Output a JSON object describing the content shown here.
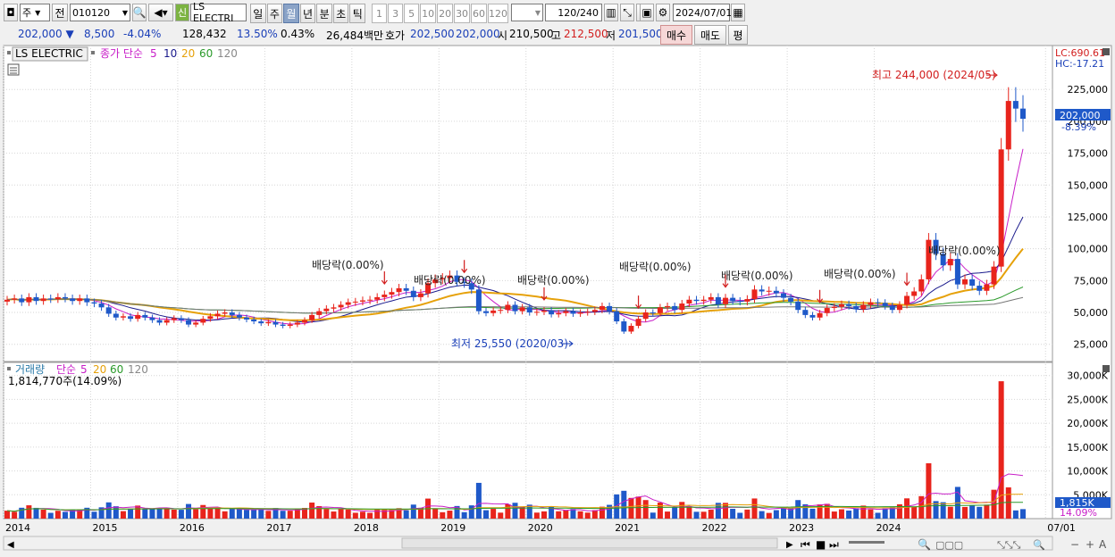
{
  "toolbar": {
    "type_label": "주",
    "prev_label": "전",
    "code_value": "010120",
    "new_label": "신",
    "stock_name": "LS ELECTRI",
    "period_tabs": [
      "일",
      "주",
      "월",
      "년",
      "분",
      "초",
      "틱"
    ],
    "active_period": "월",
    "interval_buttons": [
      "1",
      "3",
      "5",
      "10",
      "20",
      "30",
      "60",
      "120"
    ],
    "count_value": "120",
    "count_max": "/240",
    "date_value": "2024/07/01"
  },
  "quote": {
    "price": "202,000 ▼",
    "change": "8,500",
    "change_pct": "-4.04%",
    "volume": "128,432",
    "turnover_pct": "13.50%",
    "ratio": "0.43%",
    "amount": "26,484백만",
    "ask_label": "호가",
    "ask_sell": "202,500",
    "ask_buy": "202,000",
    "open_label": "시",
    "open": "210,500",
    "high_label": "고",
    "high": "212,500",
    "low_label": "저",
    "low": "201,500",
    "buy_button": "매수",
    "sell_button": "매도",
    "eval_button": "평"
  },
  "colors": {
    "up": "#e8241c",
    "down": "#1f59c9",
    "ma5": "#c81ec8",
    "ma10": "#1a1a8c",
    "ma20": "#e6a10a",
    "ma60": "#2a9a2a",
    "ma120": "#777777"
  },
  "chart_data": [
    {
      "type": "candlestick",
      "title": "LS ELECTRIC",
      "interval": "monthly",
      "legend": {
        "prefix": "종가 단순",
        "periods": [
          "5",
          "10",
          "20",
          "60",
          "120"
        ]
      },
      "ylim": [
        15000,
        256000
      ],
      "y_ticks": [
        "25,000",
        "50,000",
        "75,000",
        "100,000",
        "125,000",
        "150,000",
        "175,000",
        "200,000",
        "225,000"
      ],
      "y_tick_values": [
        25000,
        50000,
        75000,
        100000,
        125000,
        150000,
        175000,
        200000,
        225000
      ],
      "x_tick_labels": [
        "2014",
        "2015",
        "2016",
        "2017",
        "2018",
        "2019",
        "2020",
        "2021",
        "2022",
        "2023",
        "2024",
        "07/01"
      ],
      "close_series": [
        60000,
        61000,
        58000,
        62000,
        59000,
        61000,
        60500,
        62000,
        61000,
        59000,
        61000,
        58000,
        57000,
        54000,
        49000,
        46000,
        47000,
        45000,
        48000,
        46000,
        44000,
        42000,
        44000,
        45500,
        44000,
        40500,
        42000,
        45000,
        47000,
        49000,
        50000,
        48000,
        46000,
        44500,
        43000,
        41500,
        42500,
        40500,
        39500,
        40500,
        42000,
        44000,
        48000,
        51000,
        53000,
        54000,
        56000,
        58000,
        58500,
        59500,
        60000,
        62000,
        64000,
        66000,
        69000,
        67000,
        62000,
        65000,
        73000,
        76000,
        77000,
        79000,
        74000,
        73000,
        68000,
        51000,
        49500,
        51500,
        52000,
        56000,
        51000,
        54000,
        50000,
        50500,
        51500,
        48500,
        49500,
        51000,
        49000,
        50000,
        50500,
        52000,
        55000,
        51000,
        43000,
        35000,
        39500,
        45000,
        50000,
        49500,
        54000,
        55000,
        52000,
        57000,
        60000,
        59000,
        60000,
        62000,
        56500,
        61500,
        59000,
        58500,
        60500,
        68000,
        66500,
        67000,
        65000,
        61500,
        58500,
        52000,
        48000,
        46000,
        49500,
        53500,
        54500,
        56500,
        55000,
        52500,
        56000,
        58000,
        57500,
        55000,
        52000,
        56000,
        63000,
        66500,
        76000,
        107000,
        96000,
        87000,
        92000,
        72000,
        76000,
        71000,
        67000,
        72000,
        86000,
        178000,
        216000,
        210000,
        202000
      ],
      "annotations": {
        "high": {
          "label": "최고 244,000 (2024/05)",
          "value": 244000
        },
        "low": {
          "label": "최저 25,550 (2020/03)",
          "value": 25550
        },
        "dividend_label": "배당락(0.00%)",
        "lc": "LC:690.61",
        "hc": "HC:-17.21",
        "last_price": "202,000",
        "last_pct": "-8.39%"
      }
    },
    {
      "type": "bar",
      "title": "거래량",
      "legend": {
        "prefix": "단순",
        "periods": [
          "5",
          "20",
          "60",
          "120"
        ]
      },
      "info": "1,814,770주(14.09%)",
      "ylim": [
        0,
        32000000
      ],
      "y_ticks": [
        "5,000K",
        "10,000K",
        "15,000K",
        "20,000K",
        "25,000K",
        "30,000K"
      ],
      "y_tick_values": [
        5000000,
        10000000,
        15000000,
        20000000,
        25000000,
        30000000
      ],
      "last_volume": "1,815K",
      "last_pct": "14.09%"
    }
  ]
}
